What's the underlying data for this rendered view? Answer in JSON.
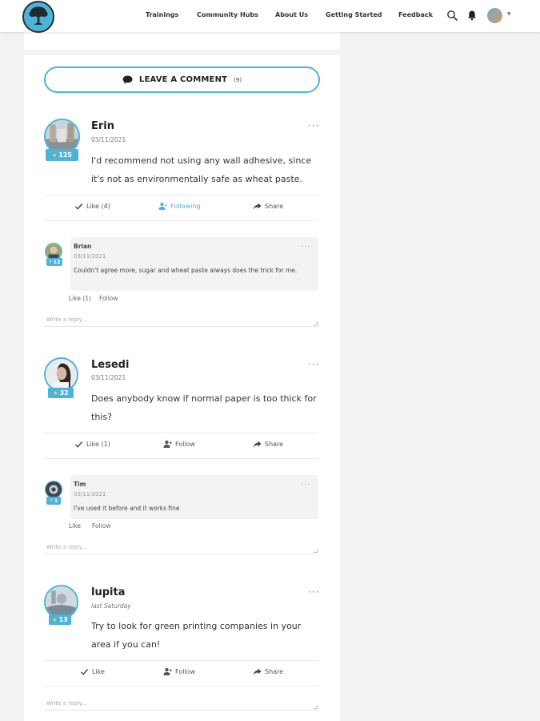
{
  "nav": {
    "items": [
      "Trainings",
      "Community Hubs",
      "About Us",
      "Getting Started",
      "Feedback"
    ]
  },
  "colors": {
    "accent": "#4db3d9",
    "star": "#ffd54a"
  },
  "comments_section": {
    "leave_label": "LEAVE A COMMENT",
    "count": "(9)"
  },
  "comments": [
    {
      "name": "Erin",
      "date": "03/11/2021",
      "points": "125",
      "text": "I'd recommend not using any wall adhesive, since it's not as environmentally safe as wheat paste.",
      "like": "Like (4)",
      "follow": "Following",
      "share": "Share",
      "reply": {
        "name": "Brian",
        "date": "03/11/2021",
        "points": "12",
        "text": "Couldn't agree more, sugar and wheat paste always does the trick for me.",
        "like": "Like (1)",
        "follow": "Follow"
      },
      "write_placeholder": "Write a reply..."
    },
    {
      "name": "Lesedi",
      "date": "03/11/2021",
      "points": "32",
      "text": "Does anybody know if normal paper is too thick for this?",
      "like": "Like (1)",
      "follow": "Follow",
      "share": "Share",
      "reply": {
        "name": "Tim",
        "date": "03/11/2021",
        "points": "1",
        "text": "I've used it before and it works fine",
        "like": "Like",
        "follow": "Follow"
      },
      "write_placeholder": "Write a reply..."
    },
    {
      "name": "lupita",
      "date": "last Saturday",
      "points": "13",
      "text": "Try to look for green printing companies in your area if you can!",
      "like": "Like",
      "follow": "Follow",
      "share": "Share",
      "write_placeholder": "Write a reply..."
    }
  ]
}
